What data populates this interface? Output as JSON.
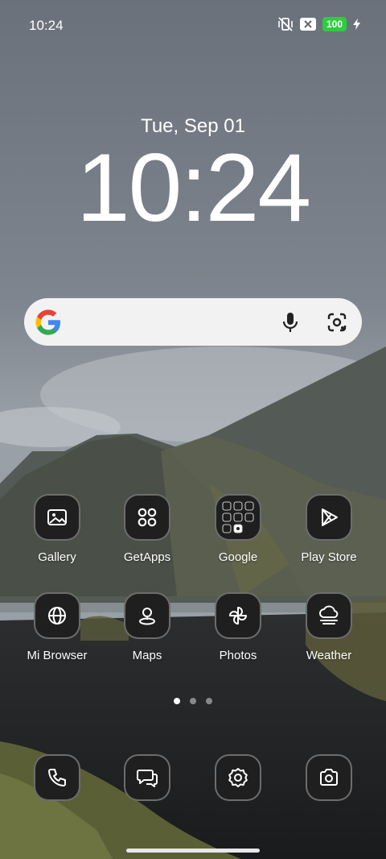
{
  "status_bar": {
    "time": "10:24",
    "icons": [
      "vibrate-off-icon",
      "notification-x-icon",
      "battery-icon",
      "charging-icon"
    ],
    "battery_level": "100",
    "battery_color": "#2ecc40"
  },
  "lockscreen": {
    "date": "Tue, Sep 01",
    "time": "10:24"
  },
  "search_widget": {
    "logo": "google-g-icon",
    "icons": [
      "microphone-icon",
      "google-lens-icon"
    ]
  },
  "apps": [
    {
      "label": "Gallery",
      "icon": "gallery-icon"
    },
    {
      "label": "GetApps",
      "icon": "four-circles-icon"
    },
    {
      "label": "Google",
      "icon": "folder-icon"
    },
    {
      "label": "Play Store",
      "icon": "play-store-icon"
    },
    {
      "label": "Mi Browser",
      "icon": "globe-icon"
    },
    {
      "label": "Maps",
      "icon": "map-pin-icon"
    },
    {
      "label": "Photos",
      "icon": "pinwheel-icon"
    },
    {
      "label": "Weather",
      "icon": "cloud-fog-icon"
    }
  ],
  "page_indicator": {
    "pages": 3,
    "current": 1
  },
  "dock": [
    {
      "icon": "phone-icon"
    },
    {
      "icon": "messages-icon"
    },
    {
      "icon": "settings-icon"
    },
    {
      "icon": "camera-icon"
    }
  ]
}
